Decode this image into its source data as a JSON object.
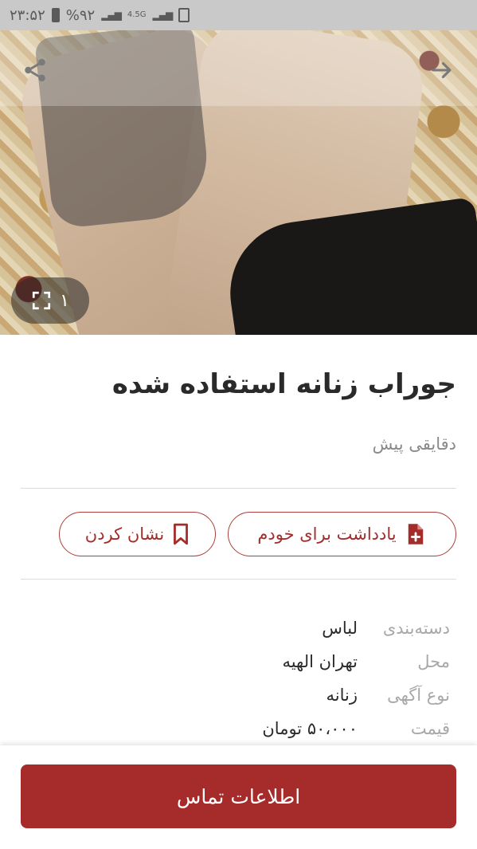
{
  "status_bar": {
    "time": "۲۳:۵۲",
    "battery": "%۹۲",
    "network": "4.5G"
  },
  "gallery": {
    "image_count": "۱"
  },
  "ad": {
    "title": "جوراب زنانه استفاده شده",
    "time_ago": "دقایقی پیش"
  },
  "actions": {
    "note_label": "یادداشت برای خودم",
    "bookmark_label": "نشان کردن"
  },
  "details": [
    {
      "key": "دسته‌بندی",
      "value": "لباس"
    },
    {
      "key": "محل",
      "value": "تهران الهیه"
    },
    {
      "key": "نوع آگهی",
      "value": "زنانه"
    },
    {
      "key": "قیمت",
      "value": "۵۰،۰۰۰ تومان"
    }
  ],
  "contact_button": "اطلاعات تماس",
  "colors": {
    "accent": "#a62b2b",
    "status_bar": "#c9c9c9"
  }
}
